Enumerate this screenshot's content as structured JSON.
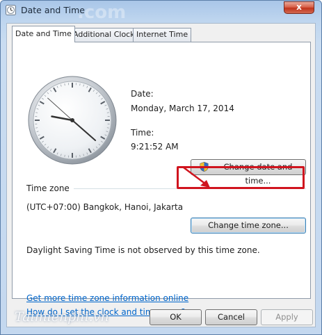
{
  "window": {
    "title": "Date and Time",
    "close_glyph": "x"
  },
  "tabs": [
    {
      "label": "Date and Time",
      "active": true
    },
    {
      "label": "Additional Clocks",
      "active": false
    },
    {
      "label": "Internet Time",
      "active": false
    }
  ],
  "date_section": {
    "date_label": "Date:",
    "date_value": "Monday, March 17, 2014",
    "time_label": "Time:",
    "time_value": "9:21:52 AM",
    "change_date_time_button": "Change date and time..."
  },
  "clock": {
    "hour": 9,
    "minute": 21,
    "second": 52
  },
  "time_zone_section": {
    "heading": "Time zone",
    "value": "(UTC+07:00) Bangkok, Hanoi, Jakarta",
    "change_time_zone_button": "Change time zone...",
    "dst_note": "Daylight Saving Time is not observed by this time zone."
  },
  "links": {
    "more_info": "Get more time zone information online",
    "how_to": "How do I set the clock and time zone?"
  },
  "footer": {
    "ok": "OK",
    "cancel": "Cancel",
    "apply": "Apply"
  },
  "watermark": "Taimienphi.vn",
  "background_watermark": ".com",
  "colors": {
    "highlight": "#d0141e",
    "link": "#0066cc",
    "accent_arrow": "#d0141e"
  },
  "icons": {
    "title_icon": "clock-icon",
    "shield": "uac-shield-icon"
  }
}
